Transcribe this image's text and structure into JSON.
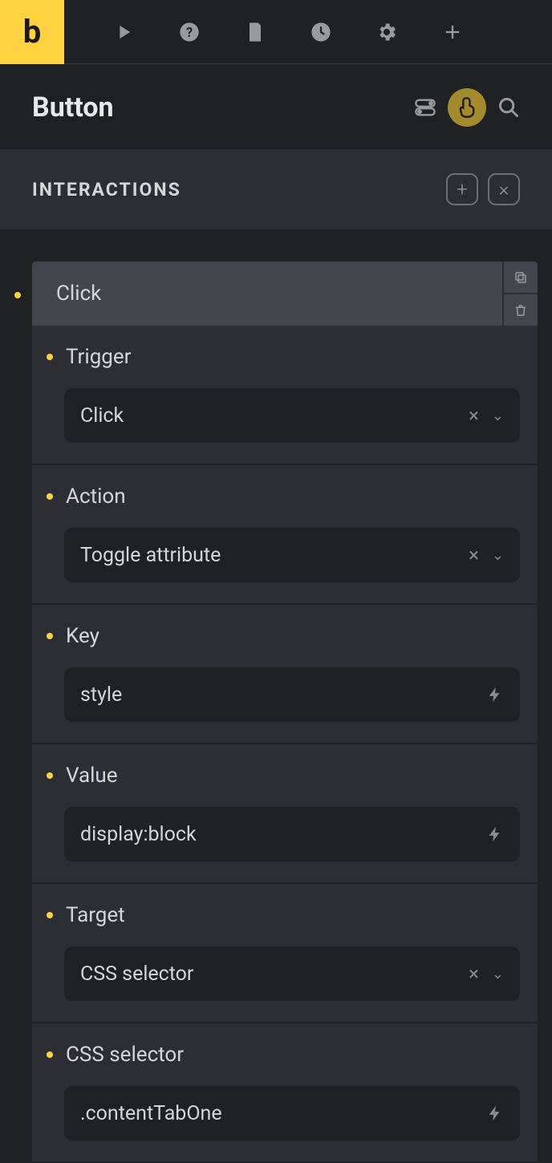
{
  "app": {
    "logo_letter": "b"
  },
  "header": {
    "title": "Button"
  },
  "section": {
    "title": "INTERACTIONS"
  },
  "interaction": {
    "title": "Click",
    "fields": {
      "trigger": {
        "label": "Trigger",
        "value": "Click"
      },
      "action": {
        "label": "Action",
        "value": "Toggle attribute"
      },
      "key": {
        "label": "Key",
        "value": "style"
      },
      "value": {
        "label": "Value",
        "value": "display:block"
      },
      "target": {
        "label": "Target",
        "value": "CSS selector"
      },
      "selector": {
        "label": "CSS selector",
        "value": ".contentTabOne"
      }
    }
  }
}
